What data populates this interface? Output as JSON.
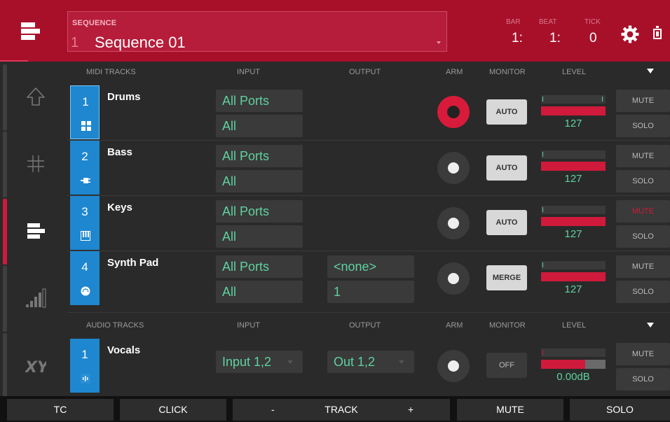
{
  "header": {
    "sequence_label": "SEQUENCE",
    "sequence_number": "1",
    "sequence_name": "Sequence 01",
    "bar_label": "BAR",
    "beat_label": "BEAT",
    "tick_label": "TICK",
    "bar_value": "1:",
    "beat_value": "1:",
    "tick_value": "0"
  },
  "sidebar": {
    "items": [
      "up-arrow-icon",
      "grid-icon",
      "track-list-icon",
      "level-bars-icon",
      "xy-icon"
    ],
    "active_index": 2
  },
  "columns": {
    "midi_tracks": "MIDI TRACKS",
    "audio_tracks": "AUDIO TRACKS",
    "input": "INPUT",
    "output": "OUTPUT",
    "arm": "ARM",
    "monitor": "MONITOR",
    "level": "LEVEL"
  },
  "midi_tracks": [
    {
      "num": "1",
      "name": "Drums",
      "icon": "drum-pads-icon",
      "input_port": "All Ports",
      "input_channel": "All",
      "output_port": "",
      "output_channel": "",
      "armed": true,
      "monitor": "AUTO",
      "level": "127",
      "level_fraction": 1.0,
      "mute": "MUTE",
      "solo": "SOLO",
      "muted": false
    },
    {
      "num": "2",
      "name": "Bass",
      "icon": "plug-icon",
      "input_port": "All Ports",
      "input_channel": "All",
      "output_port": "",
      "output_channel": "",
      "armed": false,
      "monitor": "AUTO",
      "level": "127",
      "level_fraction": 1.0,
      "mute": "MUTE",
      "solo": "SOLO",
      "muted": false
    },
    {
      "num": "3",
      "name": "Keys",
      "icon": "piano-keys-icon",
      "input_port": "All Ports",
      "input_channel": "All",
      "output_port": "",
      "output_channel": "",
      "armed": false,
      "monitor": "AUTO",
      "level": "127",
      "level_fraction": 1.0,
      "mute": "MUTE",
      "solo": "SOLO",
      "muted": true
    },
    {
      "num": "4",
      "name": "Synth Pad",
      "icon": "midi-port-icon",
      "input_port": "All Ports",
      "input_channel": "All",
      "output_port": "<none>",
      "output_channel": "1",
      "armed": false,
      "monitor": "MERGE",
      "level": "127",
      "level_fraction": 1.0,
      "mute": "MUTE",
      "solo": "SOLO",
      "muted": false
    }
  ],
  "audio_tracks": [
    {
      "num": "1",
      "name": "Vocals",
      "icon": "waveform-icon",
      "input": "Input 1,2",
      "output": "Out 1,2",
      "armed": false,
      "monitor": "OFF",
      "level": "0.00dB",
      "level_fraction": 0.68,
      "mute": "MUTE",
      "solo": "SOLO"
    }
  ],
  "bottom": {
    "tc": "TC",
    "click": "CLICK",
    "minus": "-",
    "track": "TRACK",
    "plus": "+",
    "mute": "MUTE",
    "solo": "SOLO"
  },
  "colors": {
    "header_red": "#a8102a",
    "accent_red": "#d01a3b",
    "track_blue": "#1e87cf",
    "value_green": "#5fd1a1"
  }
}
